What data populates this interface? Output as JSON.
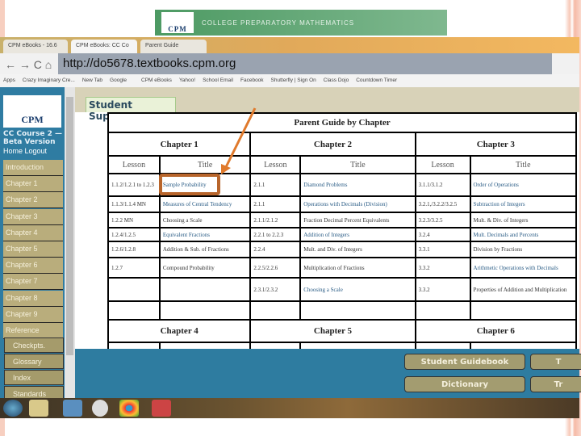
{
  "banner": {
    "logo": "CPM",
    "text": "COLLEGE PREPARATORY MATHEMATICS"
  },
  "browser": {
    "tabs": [
      "CPM eBooks - 16.6",
      "CPM eBooks: CC Co",
      "Parent Guide"
    ],
    "nav_icons": "← → C ⌂",
    "url": "http://do5678.textbooks.cpm.org",
    "bookmarks": [
      "Apps",
      "Crazy Imaginary Cre...",
      "New Tab",
      "Google",
      "",
      "CPM eBooks",
      "Yahoo!",
      "School Email",
      "Facebook",
      "Shutterfly | Sign On",
      "Class Dojo",
      "Countdown Timer"
    ]
  },
  "sidebar": {
    "logo": "CPM",
    "course": "CC Course 2 — Beta Version",
    "home": "Home",
    "logout": "Logout",
    "items": [
      "Introduction",
      "Chapter 1",
      "Chapter 2",
      "Chapter 3",
      "Chapter 4",
      "Chapter 5",
      "Chapter 6",
      "Chapter 7",
      "Chapter 8",
      "Chapter 9",
      "Reference"
    ],
    "subitems": [
      "Checkpts.",
      "Glossary",
      "Index",
      "Standards"
    ]
  },
  "page": {
    "tab": "Student Support",
    "table_title": "Parent Guide by Chapter",
    "chapters_top": [
      "Chapter 1",
      "Chapter 2",
      "Chapter 3"
    ],
    "chapters_bottom": [
      "Chapter 4",
      "Chapter 5",
      "Chapter 6"
    ],
    "col_lesson": "Lesson",
    "col_title": "Title",
    "rows": [
      [
        [
          "1.1.2/1.2.1 to 1.2.3",
          0
        ],
        [
          "Sample Probability",
          1
        ],
        [
          "2.1.1",
          0
        ],
        [
          "Diamond Problems",
          1
        ],
        [
          "3.1.1/3.1.2",
          0
        ],
        [
          "Order of Operations",
          1
        ]
      ],
      [
        [
          "1.1.3/1.1.4 MN",
          0
        ],
        [
          "Measures of Central Tendency",
          1
        ],
        [
          "2.1.1",
          0
        ],
        [
          "Operations with Decimals (Division)",
          1
        ],
        [
          "3.2.1,/3.2.2/3.2.5",
          0
        ],
        [
          "Subtraction of Integers",
          1
        ]
      ],
      [
        [
          "1.2.2 MN",
          0
        ],
        [
          "Choosing a Scale",
          0
        ],
        [
          "2.1.1/2.1.2",
          0
        ],
        [
          "Fraction Decimal Percent Equivalents",
          0
        ],
        [
          "3.2.3/3.2.5",
          0
        ],
        [
          "Mult. & Div. of Integers",
          0
        ]
      ],
      [
        [
          "1.2.4/1.2.5",
          0
        ],
        [
          "Equivalent Fractions",
          1
        ],
        [
          "2.2.1 to 2.2.3",
          0
        ],
        [
          "Addition of Integers",
          1
        ],
        [
          "3.2.4",
          0
        ],
        [
          "Mult. Decimals and Percents",
          1
        ]
      ],
      [
        [
          "1.2.6/1.2.8",
          0
        ],
        [
          "Addition & Sub. of Fractions",
          0
        ],
        [
          "2.2.4",
          0
        ],
        [
          "Mult. and Div. of Integers",
          0
        ],
        [
          "3.3.1",
          0
        ],
        [
          "Division by Fractions",
          0
        ]
      ],
      [
        [
          "1.2.7",
          0
        ],
        [
          "Compound Probability",
          0
        ],
        [
          "2.2.5/2.2.6",
          0
        ],
        [
          "Multiplication of Fractions",
          0
        ],
        [
          "3.3.2",
          0
        ],
        [
          "Arithmetic Operations with Decimals",
          1
        ]
      ],
      [
        [
          "",
          0
        ],
        [
          "",
          0
        ],
        [
          "2.3.1/2.3.2",
          0
        ],
        [
          "Choosing a Scale",
          1
        ],
        [
          "3.3.2",
          0
        ],
        [
          "Properties of Addition and Multiplication",
          0
        ]
      ]
    ]
  },
  "bottom_buttons": [
    "Student Guidebook",
    "T",
    "Dictionary",
    "Tr"
  ],
  "colors": {
    "sidebar": "#2f7ca2",
    "nav": "#b9ad7c",
    "highlight": "#b8652b",
    "arrow": "#e07a2c"
  }
}
